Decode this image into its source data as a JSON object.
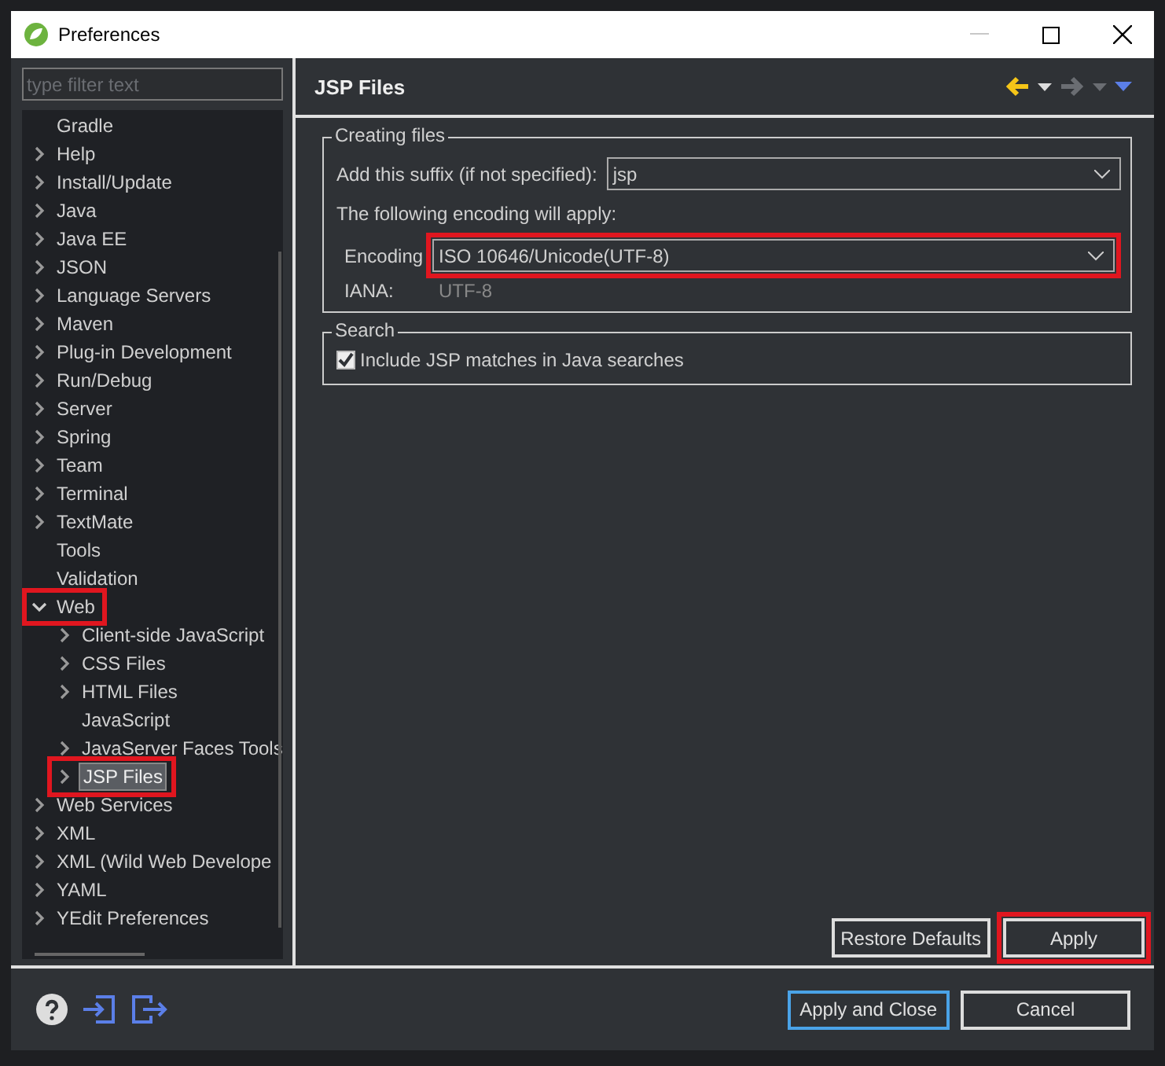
{
  "window": {
    "title": "Preferences"
  },
  "filter": {
    "placeholder": "type filter text"
  },
  "tree": [
    {
      "label": "Gradle",
      "kind": "leaf",
      "selected": false,
      "highlighted": false
    },
    {
      "label": "Help",
      "kind": "collapsed",
      "selected": false,
      "highlighted": false
    },
    {
      "label": "Install/Update",
      "kind": "collapsed",
      "selected": false,
      "highlighted": false
    },
    {
      "label": "Java",
      "kind": "collapsed",
      "selected": false,
      "highlighted": false
    },
    {
      "label": "Java EE",
      "kind": "collapsed",
      "selected": false,
      "highlighted": false
    },
    {
      "label": "JSON",
      "kind": "collapsed",
      "selected": false,
      "highlighted": false
    },
    {
      "label": "Language Servers",
      "kind": "collapsed",
      "selected": false,
      "highlighted": false
    },
    {
      "label": "Maven",
      "kind": "collapsed",
      "selected": false,
      "highlighted": false
    },
    {
      "label": "Plug-in Development",
      "kind": "collapsed",
      "selected": false,
      "highlighted": false
    },
    {
      "label": "Run/Debug",
      "kind": "collapsed",
      "selected": false,
      "highlighted": false
    },
    {
      "label": "Server",
      "kind": "collapsed",
      "selected": false,
      "highlighted": false
    },
    {
      "label": "Spring",
      "kind": "collapsed",
      "selected": false,
      "highlighted": false
    },
    {
      "label": "Team",
      "kind": "collapsed",
      "selected": false,
      "highlighted": false
    },
    {
      "label": "Terminal",
      "kind": "collapsed",
      "selected": false,
      "highlighted": false
    },
    {
      "label": "TextMate",
      "kind": "collapsed",
      "selected": false,
      "highlighted": false
    },
    {
      "label": "Tools",
      "kind": "leaf",
      "selected": false,
      "highlighted": false
    },
    {
      "label": "Validation",
      "kind": "leaf",
      "selected": false,
      "highlighted": false
    },
    {
      "label": "Web",
      "kind": "expanded",
      "selected": false,
      "highlighted": true,
      "children": [
        {
          "label": "Client-side JavaScript",
          "kind": "collapsed",
          "selected": false,
          "highlighted": false
        },
        {
          "label": "CSS Files",
          "kind": "collapsed",
          "selected": false,
          "highlighted": false
        },
        {
          "label": "HTML Files",
          "kind": "collapsed",
          "selected": false,
          "highlighted": false
        },
        {
          "label": "JavaScript",
          "kind": "leaf",
          "selected": false,
          "highlighted": false
        },
        {
          "label": "JavaServer Faces Tools",
          "kind": "collapsed",
          "selected": false,
          "highlighted": false
        },
        {
          "label": "JSP Files",
          "kind": "collapsed",
          "selected": true,
          "highlighted": true
        }
      ]
    },
    {
      "label": "Web Services",
      "kind": "collapsed",
      "selected": false,
      "highlighted": false
    },
    {
      "label": "XML",
      "kind": "collapsed",
      "selected": false,
      "highlighted": false
    },
    {
      "label": "XML (Wild Web Develope",
      "kind": "collapsed",
      "selected": false,
      "highlighted": false
    },
    {
      "label": "YAML",
      "kind": "collapsed",
      "selected": false,
      "highlighted": false
    },
    {
      "label": "YEdit Preferences",
      "kind": "collapsed",
      "selected": false,
      "highlighted": false
    }
  ],
  "page": {
    "title": "JSP Files"
  },
  "creating_group": {
    "legend": "Creating files",
    "suffix_label": "Add this suffix (if not specified):",
    "suffix_value": "jsp",
    "encoding_note": "The following encoding will apply:",
    "encoding_label": "Encoding",
    "encoding_value": "ISO 10646/Unicode(UTF-8)",
    "encoding_highlighted": true,
    "iana_label": "IANA:",
    "iana_value": "UTF-8"
  },
  "search_group": {
    "legend": "Search",
    "checkbox_label": "Include JSP matches in Java searches",
    "checked": true
  },
  "page_buttons": [
    {
      "label": "Restore Defaults",
      "highlighted": false
    },
    {
      "label": "Apply",
      "highlighted": true
    }
  ],
  "dialog_buttons": [
    {
      "label": "Apply and Close",
      "default": true
    },
    {
      "label": "Cancel",
      "default": false
    }
  ]
}
